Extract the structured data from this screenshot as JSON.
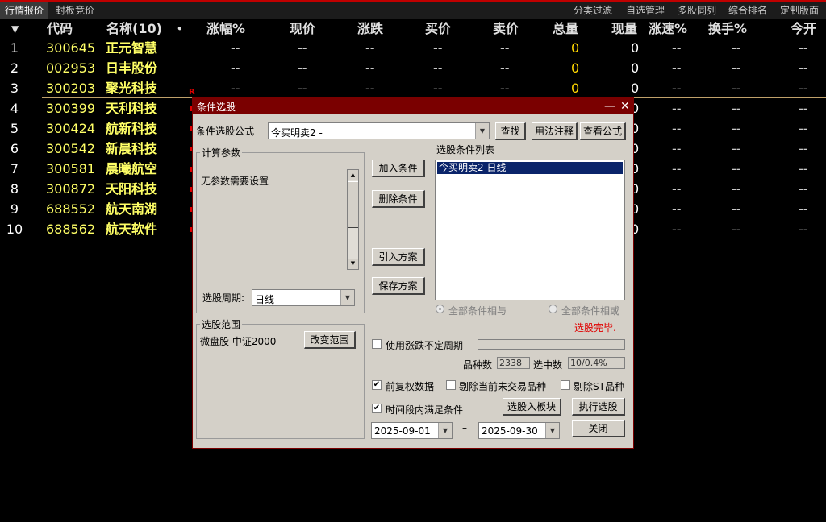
{
  "tabs": [
    "行情报价",
    "封板竞价"
  ],
  "menu": [
    "分类过滤",
    "自选管理",
    "多股同列",
    "综合排名",
    "定制版面"
  ],
  "table": {
    "sort_icon": "▼",
    "headers": {
      "code": "代码",
      "name": "名称(10)",
      "dot": "•",
      "change_pct": "涨幅%",
      "price": "现价",
      "change": "涨跌",
      "bid": "买价",
      "ask": "卖价",
      "volume": "总量",
      "cur_vol": "现量",
      "speed": "涨速%",
      "turnover": "换手%",
      "open": "今开"
    },
    "rows": [
      {
        "n": "1",
        "code": "300645",
        "name": "正元智慧",
        "vol": "0",
        "cur": "0"
      },
      {
        "n": "2",
        "code": "002953",
        "name": "日丰股份",
        "vol": "0",
        "cur": "0"
      },
      {
        "n": "3",
        "code": "300203",
        "name": "聚光科技",
        "vol": "0",
        "cur": "0"
      },
      {
        "n": "4",
        "code": "300399",
        "name": "天利科技",
        "vol": "",
        "cur": "0"
      },
      {
        "n": "5",
        "code": "300424",
        "name": "航新科技",
        "vol": "",
        "cur": "0"
      },
      {
        "n": "6",
        "code": "300542",
        "name": "新晨科技",
        "vol": "",
        "cur": "0"
      },
      {
        "n": "7",
        "code": "300581",
        "name": "晨曦航空",
        "vol": "",
        "cur": "0"
      },
      {
        "n": "8",
        "code": "300872",
        "name": "天阳科技",
        "vol": "",
        "cur": "0"
      },
      {
        "n": "9",
        "code": "688552",
        "name": "航天南湖",
        "vol": "",
        "cur": "0"
      },
      {
        "n": "10",
        "code": "688562",
        "name": "航天软件",
        "vol": "",
        "cur": "0"
      }
    ],
    "dash": "--",
    "marker": "R"
  },
  "dialog": {
    "title": "条件选股",
    "minimize": "—",
    "close": "✕",
    "formula_label": "条件选股公式",
    "formula_value": "今买明卖2   -",
    "find_btn": "查找",
    "usage_btn": "用法注释",
    "view_btn": "查看公式",
    "params_group": "计算参数",
    "params_text": "无参数需要设置",
    "period_label": "选股周期:",
    "period_value": "日线",
    "scope_group": "选股范围",
    "scope_text": "微盘股  中证2000",
    "scope_btn": "改变范围",
    "add_btn": "加入条件",
    "delete_btn": "删除条件",
    "import_btn": "引入方案",
    "save_btn": "保存方案",
    "list_title": "选股条件列表",
    "list_item": "今买明卖2   日线",
    "radio_and": "全部条件相与",
    "radio_or": "全部条件相或",
    "status": "选股完毕.",
    "variable_period_label": "使用涨跌不定周期",
    "count_label": "品种数",
    "count_value": "2338",
    "selected_label": "选中数",
    "selected_value": "10/0.4%",
    "adj_label": "前复权数据",
    "exclude_untraded_label": "剔除当前未交易品种",
    "exclude_st_label": "剔除ST品种",
    "time_range_label": "时间段内满足条件",
    "to_board_btn": "选股入板块",
    "execute_btn": "执行选股",
    "close_btn": "关闭",
    "date_from": "2025-09-01",
    "date_sep": "–",
    "date_to": "2025-09-30",
    "checks": {
      "variable_period": false,
      "adj": true,
      "exclude_untraded": false,
      "exclude_st": false,
      "time_range": true
    },
    "checkmark": "✔"
  }
}
